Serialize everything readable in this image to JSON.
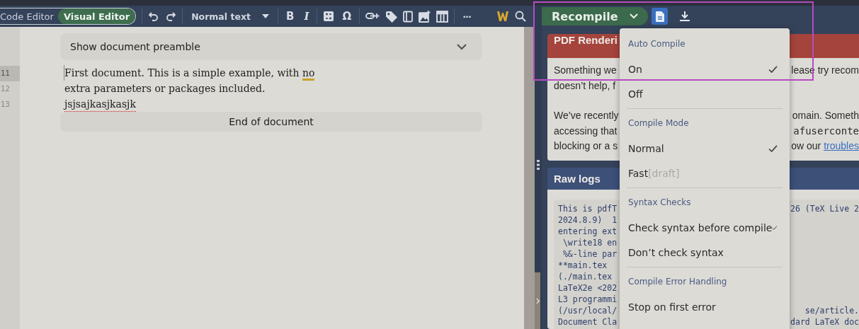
{
  "toolbar": {
    "editor_modes": [
      {
        "label": "Code Editor",
        "selected": false
      },
      {
        "label": "Visual Editor",
        "selected": true
      }
    ],
    "text_style": "Normal text",
    "bold_label": "B",
    "italic_label": "I",
    "symbol_label": "Ω",
    "more_label": "···"
  },
  "editor": {
    "preamble_toggle": "Show document preamble",
    "lines": [
      {
        "number": "11",
        "active": true,
        "segments": [
          {
            "text": "First document. This is a simple example, with ",
            "grammar_issue": false,
            "spelling_issue": false
          },
          {
            "text": "no",
            "grammar_issue": true,
            "spelling_issue": false
          }
        ]
      },
      {
        "number": "12",
        "active": false,
        "segments": [
          {
            "text": "extra parameters or packages included.",
            "grammar_issue": false,
            "spelling_issue": false
          }
        ]
      },
      {
        "number": "13",
        "active": false,
        "segments": [
          {
            "text": "jsjsajkasjkasjk",
            "grammar_issue": false,
            "spelling_issue": true
          }
        ]
      }
    ],
    "end_label": "End of document"
  },
  "compile": {
    "button": "Recompile"
  },
  "error_card": {
    "title": "PDF Renderi",
    "paragraphs": [
      [
        {
          "left": "Something we",
          "right": [
            {
              "text": "lease try recom",
              "kind": "plain"
            }
          ]
        },
        {
          "left": "doesn’t help, f"
        }
      ],
      [
        {
          "left": "We’ve recently",
          "right": [
            {
              "text": "omain. Someth",
              "kind": "plain"
            }
          ]
        },
        {
          "left": "accessing that",
          "right": [
            {
              "text": "afuserconte",
              "kind": "code"
            }
          ]
        },
        {
          "left": "blocking or a s",
          "right": [
            {
              "text": "ow our ",
              "kind": "plain"
            },
            {
              "text": "troubles",
              "kind": "link"
            }
          ]
        }
      ]
    ]
  },
  "logs": {
    "title": "Raw logs",
    "lines": [
      {
        "left": "This is pdfT",
        "right": "26 (TeX Live 2"
      },
      {
        "left": "2024.8.9)  1"
      },
      {
        "left": "entering ext"
      },
      {
        "left": " \\write18 en"
      },
      {
        "left": " %&-line par"
      },
      {
        "left": "**main.tex"
      },
      {
        "left": "(./main.tex"
      },
      {
        "left": "LaTeX2e <202"
      },
      {
        "left": "L3 programmi"
      },
      {
        "left": "(/usr/local/",
        "right": "se/article."
      },
      {
        "left": "Document Cla",
        "right": "dard LaTeX doc"
      }
    ]
  },
  "compile_menu": {
    "sections": [
      {
        "title": "Auto Compile",
        "options": [
          {
            "label": "On",
            "selected": true
          },
          {
            "label": "Off",
            "selected": false
          }
        ]
      },
      {
        "title": "Compile Mode",
        "options": [
          {
            "label": "Normal",
            "selected": true
          },
          {
            "label": "Fast",
            "hint": "[draft]",
            "selected": false
          }
        ]
      },
      {
        "title": "Syntax Checks",
        "options": [
          {
            "label": "Check syntax before compile",
            "selected": true
          },
          {
            "label": "Don’t check syntax",
            "selected": false
          }
        ]
      },
      {
        "title": "Compile Error Handling",
        "options": [
          {
            "label": "Stop on first error",
            "selected": false
          }
        ]
      }
    ]
  }
}
